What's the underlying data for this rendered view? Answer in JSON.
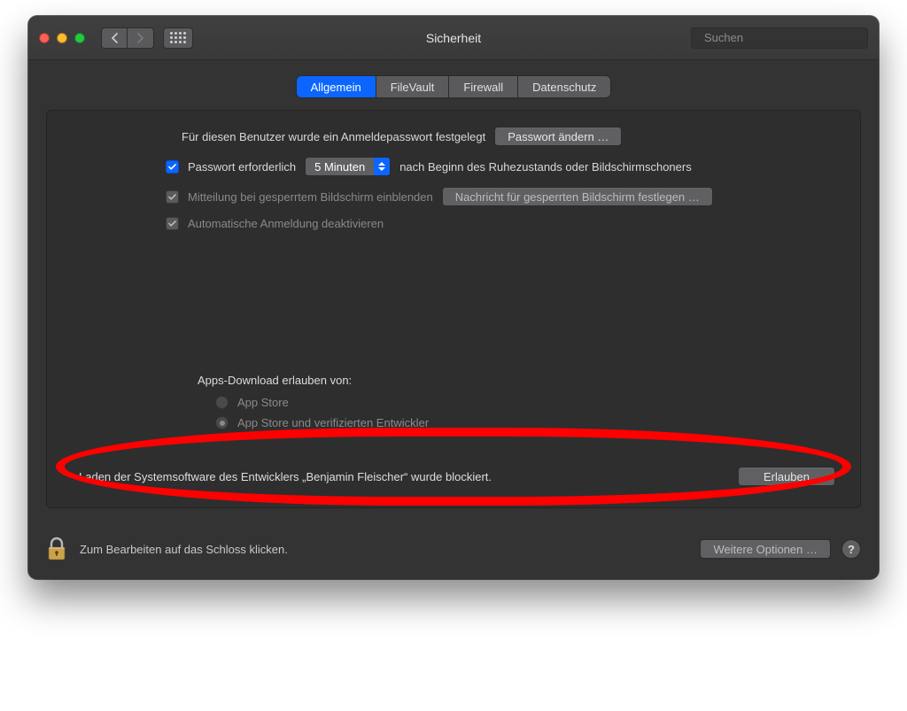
{
  "window": {
    "title": "Sicherheit"
  },
  "search": {
    "placeholder": "Suchen"
  },
  "tabs": [
    {
      "label": "Allgemein",
      "active": true
    },
    {
      "label": "FileVault",
      "active": false
    },
    {
      "label": "Firewall",
      "active": false
    },
    {
      "label": "Datenschutz",
      "active": false
    }
  ],
  "general": {
    "login_password_set_text": "Für diesen Benutzer wurde ein Anmeldepasswort festgelegt",
    "change_password_button": "Passwort ändern …",
    "require_password": {
      "prefix": "Passwort erforderlich",
      "delay_value": "5 Minuten",
      "suffix": "nach Beginn des Ruhezustands oder Bildschirmschoners"
    },
    "lock_message_checkbox": "Mitteilung bei gesperrtem Bildschirm einblenden",
    "set_lock_message_button": "Nachricht für gesperrten Bildschirm festlegen …",
    "disable_autologin_checkbox": "Automatische Anmeldung deaktivieren",
    "allow_apps_label": "Apps-Download erlauben von:",
    "allow_apps_options": [
      {
        "label": "App Store",
        "selected": false
      },
      {
        "label": "App Store und verifizierten Entwickler",
        "selected": true
      }
    ],
    "blocked_message": "Laden der Systemsoftware des Entwicklers „Benjamin Fleischer“ wurde blockiert.",
    "allow_button": "Erlauben"
  },
  "footer": {
    "lock_hint": "Zum Bearbeiten auf das Schloss klicken.",
    "more_options_button": "Weitere Optionen …"
  }
}
